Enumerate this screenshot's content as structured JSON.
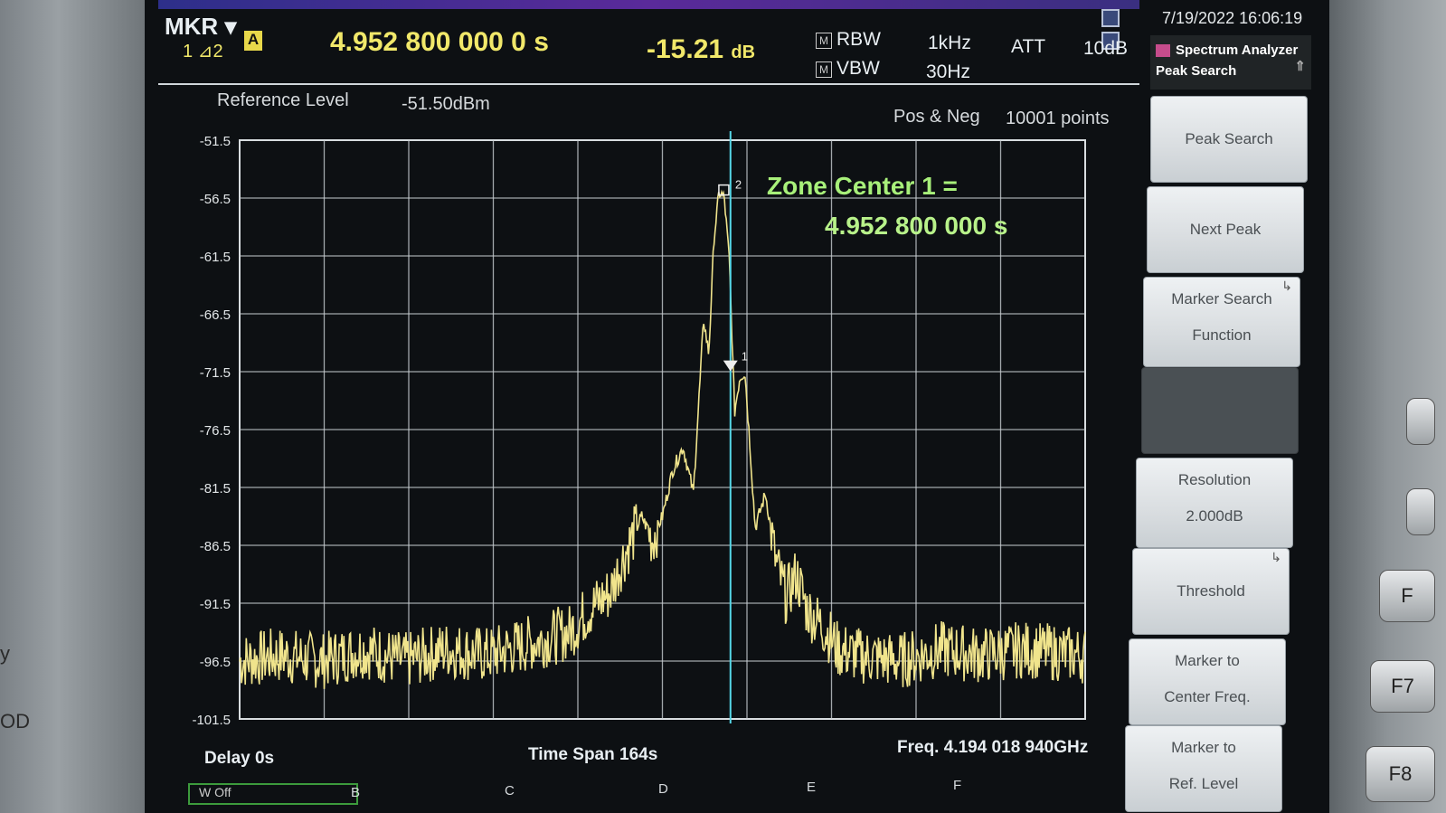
{
  "header": {
    "mkr_label": "MKR",
    "mkr_sub": "1 ⊿2",
    "mkr_mode_badge": "A",
    "marker_value": "4.952 800 000 0 s",
    "marker_delta": "-15.21",
    "marker_delta_unit": "dB",
    "rbw_label": "RBW",
    "rbw_value": "1kHz",
    "vbw_label": "VBW",
    "vbw_value": "30Hz",
    "att_label": "ATT",
    "att_value": "10dB",
    "rbw_badge": "M",
    "vbw_badge": "M"
  },
  "trace_info": {
    "reference_level_label": "Reference Level",
    "reference_level_value": "-51.50dBm",
    "detector": "Pos & Neg",
    "points": "10001 points"
  },
  "annotation": {
    "line1": "Zone Center 1 =",
    "line2": "4.952 800 000 s"
  },
  "markers": {
    "m1": "1",
    "m2": "2"
  },
  "footer": {
    "delay": "Delay 0s",
    "time_span": "Time Span 164s",
    "freq": "Freq. 4.194 018 940GHz"
  },
  "bottom_tabs": [
    "W Off",
    "B",
    "C",
    "D",
    "E",
    "F"
  ],
  "datetime": "7/19/2022 16:06:19",
  "panel": {
    "title": "Spectrum Analyzer",
    "subtitle": "Peak Search",
    "softkeys": [
      {
        "line1": "Peak Search",
        "line2": ""
      },
      {
        "line1": "Next Peak",
        "line2": ""
      },
      {
        "line1": "Marker Search",
        "line2": "Function"
      },
      {
        "line1": "",
        "line2": ""
      },
      {
        "line1": "Resolution",
        "line2": "2.000dB"
      },
      {
        "line1": "Threshold",
        "line2": ""
      },
      {
        "line1": "Marker to",
        "line2": "Center Freq."
      },
      {
        "line1": "Marker to",
        "line2": "Ref. Level"
      }
    ]
  },
  "hard_keys": [
    "F",
    "F7",
    "F8"
  ],
  "chart_data": {
    "type": "line",
    "title": "",
    "xlabel": "",
    "ylabel": "",
    "y_ticks": [
      "-51.5",
      "-56.5",
      "-61.5",
      "-66.5",
      "-71.5",
      "-76.5",
      "-81.5",
      "-86.5",
      "-91.5",
      "-96.5",
      "-101.5"
    ],
    "ylim": [
      -101.5,
      -51.5
    ],
    "xlim": [
      0,
      164
    ],
    "grid": true,
    "series": [
      {
        "color": "#f0e48c",
        "x": [
          0,
          8,
          16,
          24,
          32,
          40,
          48,
          56,
          64,
          68,
          72,
          74,
          76,
          78,
          80,
          82,
          84,
          86,
          88,
          90,
          91,
          92,
          93,
          94,
          95,
          96,
          97,
          98,
          99,
          100,
          102,
          104,
          106,
          108,
          110,
          112,
          114,
          116,
          120,
          128,
          136,
          144,
          152,
          164
        ],
        "values": [
          -96.5,
          -96.0,
          -96.5,
          -95.5,
          -96.5,
          -95.5,
          -96.0,
          -95.0,
          -94.0,
          -92.0,
          -90.5,
          -88.0,
          -86.0,
          -84.0,
          -86.0,
          -84.0,
          -80.0,
          -78.0,
          -82.0,
          -67.0,
          -70.0,
          -60.0,
          -56.0,
          -56.5,
          -62.0,
          -75.0,
          -72.0,
          -71.5,
          -78.0,
          -85.0,
          -82.0,
          -88.0,
          -91.0,
          -89.0,
          -92.0,
          -93.0,
          -94.0,
          -95.5,
          -96.0,
          -96.5,
          -95.5,
          -96.0,
          -95.5,
          -96.0
        ]
      }
    ]
  }
}
